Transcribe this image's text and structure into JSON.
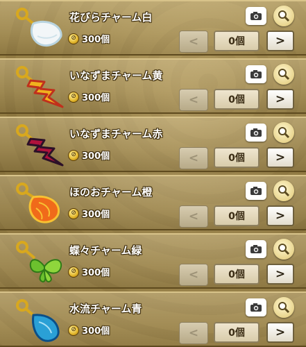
{
  "icons": {
    "camera": "camera-icon",
    "zoom": "magnifier-icon",
    "decrement": "chevron-left-icon",
    "increment": "chevron-right-icon",
    "coin": "coin-icon"
  },
  "colors": {
    "panel": "#8c7640",
    "text": "#ffffff",
    "text_outline": "#3a2a0a"
  },
  "items": [
    {
      "name": "花びらチャーム白",
      "price": "300個",
      "quantity": "0個",
      "dec": "<",
      "inc": ">",
      "charm_color": "#f2f6f8",
      "charm_edge": "#b9d4e0",
      "charm_shape": "petal"
    },
    {
      "name": "いなずまチャーム黄",
      "price": "300個",
      "quantity": "0個",
      "dec": "<",
      "inc": ">",
      "charm_color": "#f0b21e",
      "charm_edge": "#c0301c",
      "charm_shape": "bolt"
    },
    {
      "name": "いなずまチャーム赤",
      "price": "300個",
      "quantity": "0個",
      "dec": "<",
      "inc": ">",
      "charm_color": "#b0123c",
      "charm_edge": "#2c1028",
      "charm_shape": "bolt"
    },
    {
      "name": "ほのおチャーム橙",
      "price": "300個",
      "quantity": "0個",
      "dec": "<",
      "inc": ">",
      "charm_color": "#f06a1a",
      "charm_edge": "#f7c232",
      "charm_shape": "flame"
    },
    {
      "name": "蝶々チャーム緑",
      "price": "300個",
      "quantity": "0個",
      "dec": "<",
      "inc": ">",
      "charm_color": "#6cc12e",
      "charm_edge": "#2f7a16",
      "charm_shape": "butterfly"
    },
    {
      "name": "水流チャーム青",
      "price": "300個",
      "quantity": "0個",
      "dec": "<",
      "inc": ">",
      "charm_color": "#2aa0d6",
      "charm_edge": "#0b4f88",
      "charm_shape": "drop"
    }
  ]
}
